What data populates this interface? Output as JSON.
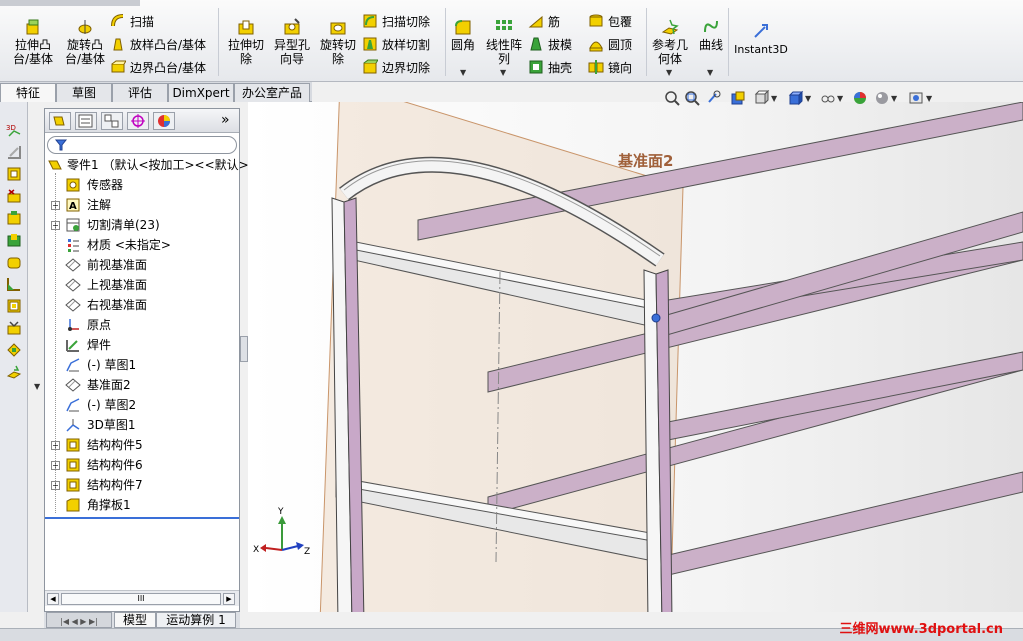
{
  "ribbon": {
    "big_buttons": [
      {
        "label": "拉伸凸\n台/基体"
      },
      {
        "label": "旋转凸\n台/基体"
      },
      {
        "label": "拉伸切\n除"
      },
      {
        "label": "异型孔\n向导"
      },
      {
        "label": "旋转切\n除"
      },
      {
        "label": "圆角"
      },
      {
        "label": "线性阵\n列"
      },
      {
        "label": "参考几\n何体"
      },
      {
        "label": "曲线"
      },
      {
        "label": "Instant3D"
      }
    ],
    "small_buttons": [
      {
        "label": "扫描"
      },
      {
        "label": "放样凸台/基体"
      },
      {
        "label": "边界凸台/基体"
      },
      {
        "label": "扫描切除"
      },
      {
        "label": "放样切割"
      },
      {
        "label": "边界切除"
      },
      {
        "label": "筋"
      },
      {
        "label": "拔模"
      },
      {
        "label": "抽壳"
      },
      {
        "label": "包覆"
      },
      {
        "label": "圆顶"
      },
      {
        "label": "镜向"
      }
    ]
  },
  "tabs": [
    {
      "label": "特征"
    },
    {
      "label": "草图"
    },
    {
      "label": "评估"
    },
    {
      "label": "DimXpert"
    },
    {
      "label": "办公室产品"
    }
  ],
  "feature_tree": {
    "items": [
      {
        "label": "零件1 （默认<按加工><<默认>",
        "icon": "part-icon"
      },
      {
        "label": "传感器",
        "icon": "sensor-icon"
      },
      {
        "label": "注解",
        "icon": "annotation-icon"
      },
      {
        "label": "切割清单(23)",
        "icon": "cut-list-icon"
      },
      {
        "label": "材质 <未指定>",
        "icon": "material-icon"
      },
      {
        "label": "前视基准面",
        "icon": "plane-icon"
      },
      {
        "label": "上视基准面",
        "icon": "plane-icon"
      },
      {
        "label": "右视基准面",
        "icon": "plane-icon"
      },
      {
        "label": "原点",
        "icon": "origin-icon"
      },
      {
        "label": "焊件",
        "icon": "weldment-icon"
      },
      {
        "label": "(-) 草图1",
        "icon": "sketch-icon"
      },
      {
        "label": "基准面2",
        "icon": "plane-icon"
      },
      {
        "label": "(-) 草图2",
        "icon": "sketch-icon"
      },
      {
        "label": "3D草图1",
        "icon": "3d-sketch-icon"
      },
      {
        "label": "结构构件5",
        "icon": "structural-member-icon"
      },
      {
        "label": "结构构件6",
        "icon": "structural-member-icon"
      },
      {
        "label": "结构构件7",
        "icon": "structural-member-icon"
      },
      {
        "label": "角撑板1",
        "icon": "gusset-icon"
      }
    ],
    "scroll_label": "III"
  },
  "bottom_tabs": [
    {
      "label": "模型"
    },
    {
      "label": "运动算例 1"
    }
  ],
  "viewport": {
    "plane_label": "基准面2",
    "axis_x": "X",
    "axis_y": "Y",
    "axis_z": "Z"
  },
  "watermark": "三维网www.3dportal.cn",
  "colors": {
    "beam": "#c8a8c8",
    "plane": "#d9a77a",
    "icon_yellow": "#f2d000",
    "icon_green": "#3aa33a",
    "watermark": "#e01010"
  }
}
